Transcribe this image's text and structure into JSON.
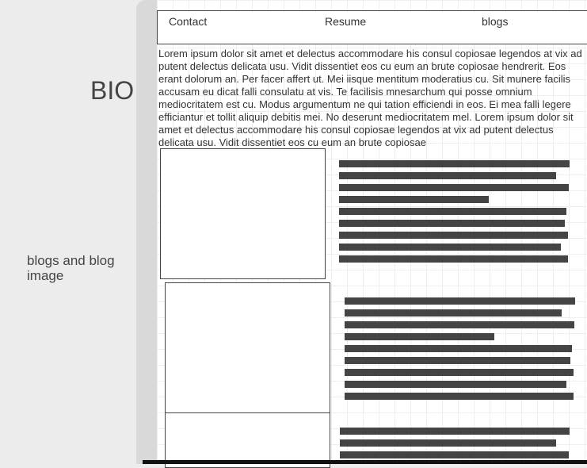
{
  "sidebar": {
    "bio_label": "BIO",
    "blogs_label": "blogs and blog image"
  },
  "nav": {
    "contact": "Contact",
    "resume": "Resume",
    "blogs": "blogs"
  },
  "bio": {
    "text": "Lorem ipsum dolor sit amet et delectus accommodare his consul copiosae legendos at vix ad putent delectus delicata usu. Vidit dissentiet eos cu eum an brute copiosae hendrerit. Eos erant dolorum an. Per facer affert ut. Mei iisque mentitum moderatius cu. Sit munere facilis accusam eu dicat falli consulatu at vis. Te facilisis mnesarchum qui posse omnium mediocritatem est cu. Modus argumentum ne qui tation efficiendi in eos. Ei mea falli legere efficiantur et tollit aliquip debitis mei. No deserunt mediocritatem mel. Lorem ipsum dolor sit amet et delectus accommodare his consul copiosae legendos at vix ad putent delectus delicata usu. Vidit dissentiet eos cu eum an brute copiosae"
  },
  "colors": {
    "placeholder_bar": "#444444",
    "sidebar_bg": "#ececec",
    "canvas_bg": "#ffffff"
  }
}
